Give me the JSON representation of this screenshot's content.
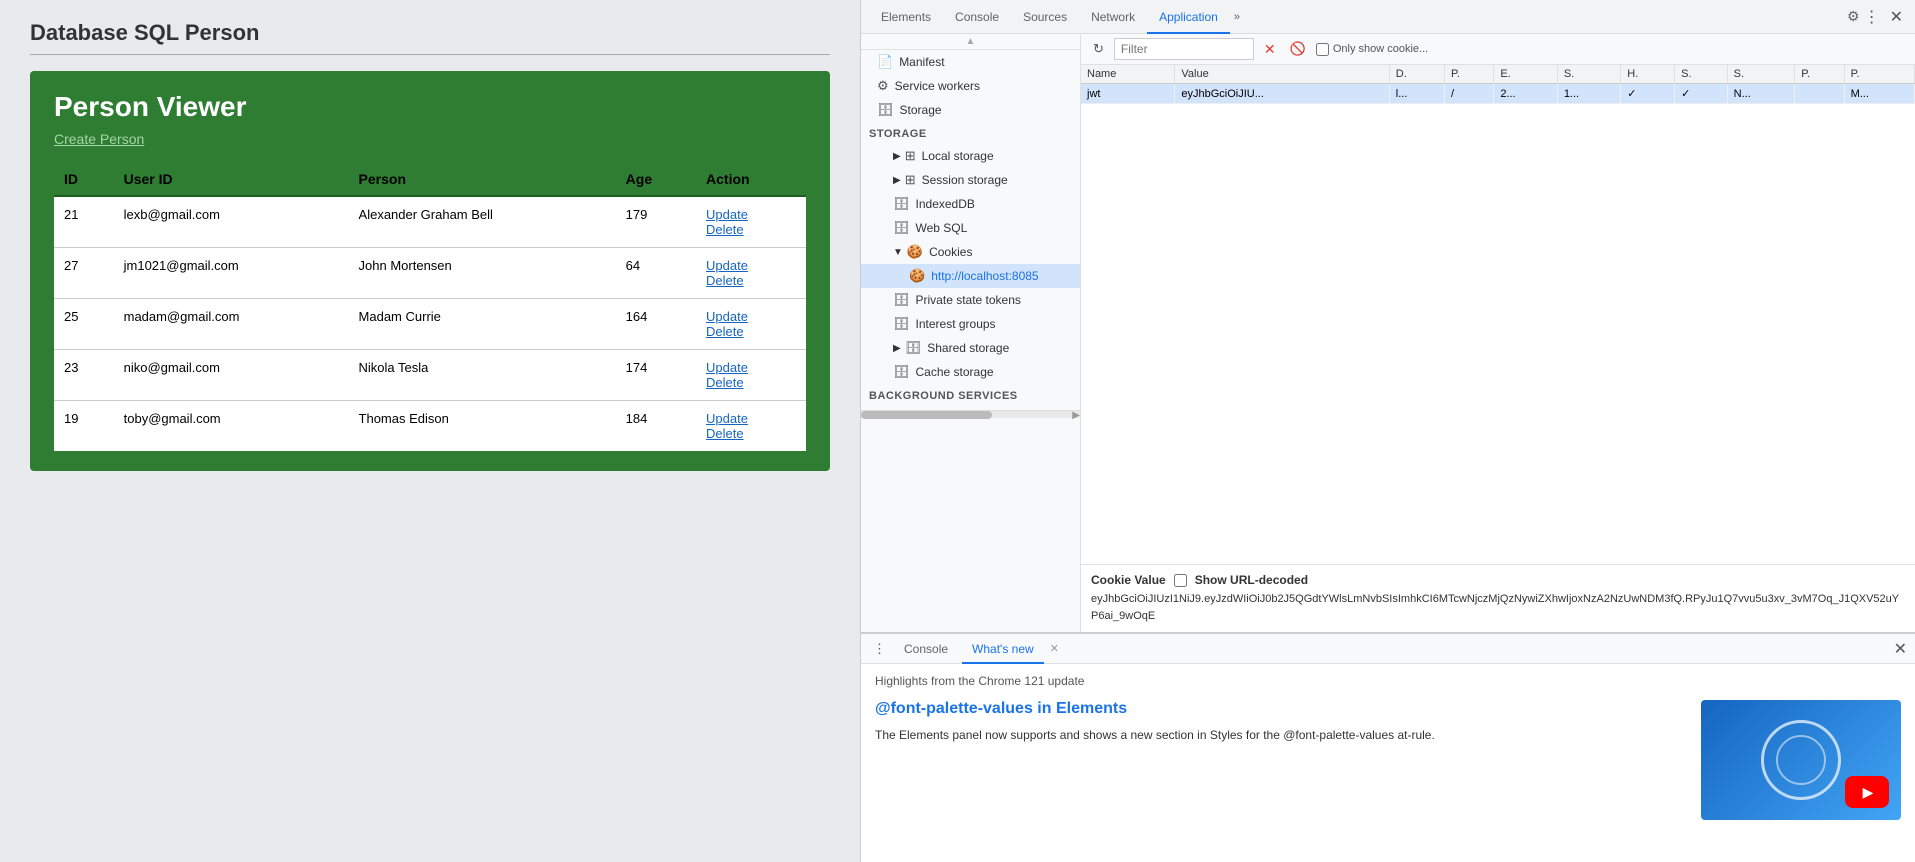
{
  "page": {
    "title": "Database SQL Person"
  },
  "card": {
    "title": "Person Viewer",
    "create_link": "Create Person"
  },
  "table": {
    "headers": [
      "ID",
      "User ID",
      "Person",
      "Age",
      "Action"
    ],
    "rows": [
      {
        "id": "21",
        "user_id": "lexb@gmail.com",
        "person": "Alexander Graham Bell",
        "age": "179",
        "actions": [
          "Update",
          "Delete"
        ]
      },
      {
        "id": "27",
        "user_id": "jm1021@gmail.com",
        "person": "John Mortensen",
        "age": "64",
        "actions": [
          "Update",
          "Delete"
        ]
      },
      {
        "id": "25",
        "user_id": "madam@gmail.com",
        "person": "Madam Currie",
        "age": "164",
        "actions": [
          "Update",
          "Delete"
        ]
      },
      {
        "id": "23",
        "user_id": "niko@gmail.com",
        "person": "Nikola Tesla",
        "age": "174",
        "actions": [
          "Update",
          "Delete"
        ]
      },
      {
        "id": "19",
        "user_id": "toby@gmail.com",
        "person": "Thomas Edison",
        "age": "184",
        "actions": [
          "Update",
          "Delete"
        ]
      }
    ]
  },
  "devtools": {
    "tabs": [
      "Elements",
      "Console",
      "Sources",
      "Network",
      "Application"
    ],
    "active_tab": "Application",
    "sidebar": {
      "manifest_label": "Manifest",
      "service_workers_label": "Service workers",
      "storage_label": "Storage",
      "storage_section": "Storage",
      "local_storage_label": "Local storage",
      "session_storage_label": "Session storage",
      "indexed_db_label": "IndexedDB",
      "web_sql_label": "Web SQL",
      "cookies_label": "Cookies",
      "cookies_host_label": "http://localhost:8085",
      "private_state_tokens_label": "Private state tokens",
      "interest_groups_label": "Interest groups",
      "shared_storage_label": "Shared storage",
      "cache_storage_label": "Cache storage",
      "background_services_label": "Background services"
    },
    "cookie_toolbar": {
      "filter_placeholder": "Filter",
      "only_show_label": "Only show cookie..."
    },
    "cookie_table": {
      "headers": [
        "Name",
        "Value",
        "D.",
        "P.",
        "E.",
        "S.",
        "H.",
        "S.",
        "S.",
        "P.",
        "P."
      ],
      "rows": [
        {
          "name": "jwt",
          "value": "eyJhbGciOiJIU...",
          "d": "l...",
          "p": "/",
          "e": "2...",
          "s1": "1...",
          "h": "✓",
          "s2": "✓",
          "s3": "N...",
          "p2": "",
          "p3": "M..."
        }
      ]
    },
    "cookie_value": {
      "label": "Cookie Value",
      "show_url_decoded_label": "Show URL-decoded",
      "value": "eyJhbGciOiJIUzI1NiJ9.eyJzdWIiOiJ0b2J5QGdtYWlsLmNvbSIsImhkCI6MTcwNjczMjQzNywiZXhwIjoxNzA2NzUwNDM3fQ.RPyJu1Q7vvu5u3xv_3vM7Oq_J1QXV52uYP6ai_9wOqE"
    },
    "bottom": {
      "console_tab": "Console",
      "whats_new_tab": "What's new",
      "highlight_text": "Highlights from the Chrome 121 update",
      "article_title": "@font-palette-values in Elements",
      "article_desc": "The Elements panel now supports and shows a new section in Styles for the @font-palette-values at-rule."
    }
  }
}
